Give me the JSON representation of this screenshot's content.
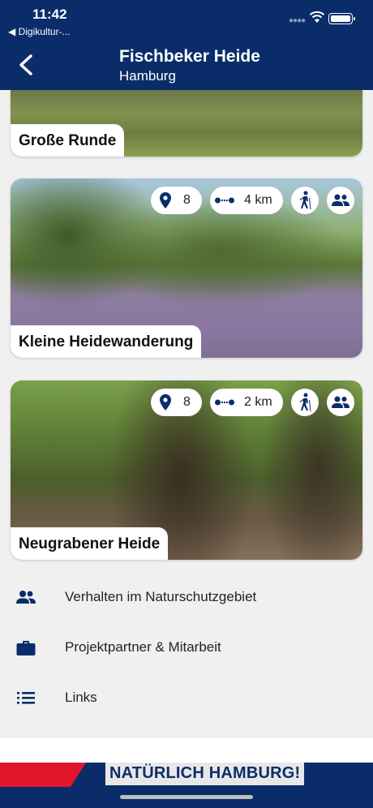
{
  "status_bar": {
    "time": "11:42",
    "back_app": "◀ Digikultur-...",
    "signal": "●●●●"
  },
  "header": {
    "title": "Fischbeker Heide",
    "subtitle": "Hamburg",
    "background_color": "#0a2d6a"
  },
  "routes": [
    {
      "name": "Große Runde"
    },
    {
      "name": "Kleine Heidewanderung",
      "markers": "8",
      "distance": "4 km"
    },
    {
      "name": "Neugrabener Heide",
      "markers": "8",
      "distance": "2 km"
    }
  ],
  "icons": {
    "marker": "map-pin-icon",
    "distance": "route-dots-icon",
    "walk": "hiker-icon",
    "group": "people-icon"
  },
  "menu": [
    {
      "label": "Verhalten im Naturschutzgebiet",
      "icon": "people-icon"
    },
    {
      "label": "Projektpartner & Mitarbeit",
      "icon": "briefcase-icon"
    },
    {
      "label": "Links",
      "icon": "list-icon"
    }
  ],
  "footer": {
    "slogan": "NATÜRLICH HAMBURG!",
    "accent_red": "#e3152a"
  }
}
